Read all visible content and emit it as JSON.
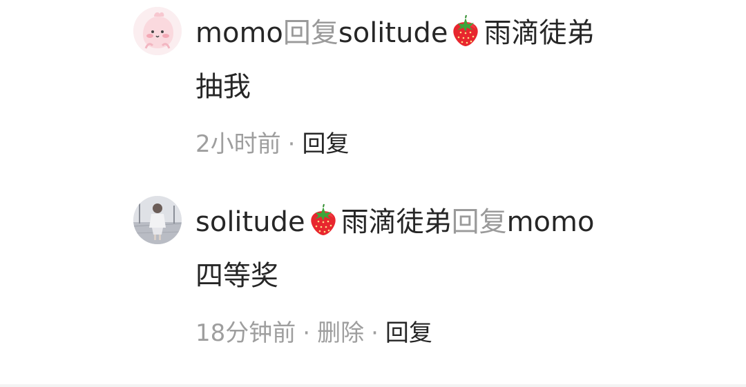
{
  "comments": [
    {
      "author": "momo",
      "reply_word": "回复",
      "target_name": "solitude",
      "target_suffix": "雨滴徒弟",
      "target_emoji": "strawberry-icon",
      "text": "抽我",
      "time": "2小时前",
      "actions": [
        "回复"
      ]
    },
    {
      "author": "solitude",
      "author_suffix": "雨滴徒弟",
      "author_emoji": "strawberry-icon",
      "reply_word": "回复",
      "target_name": "momo",
      "text": "四等奖",
      "time": "18分钟前",
      "actions": [
        "删除",
        "回复"
      ]
    }
  ],
  "separator": "·",
  "colors": {
    "text_primary": "#262626",
    "text_secondary": "#9e9e9e",
    "strawberry": "#e8262e"
  }
}
